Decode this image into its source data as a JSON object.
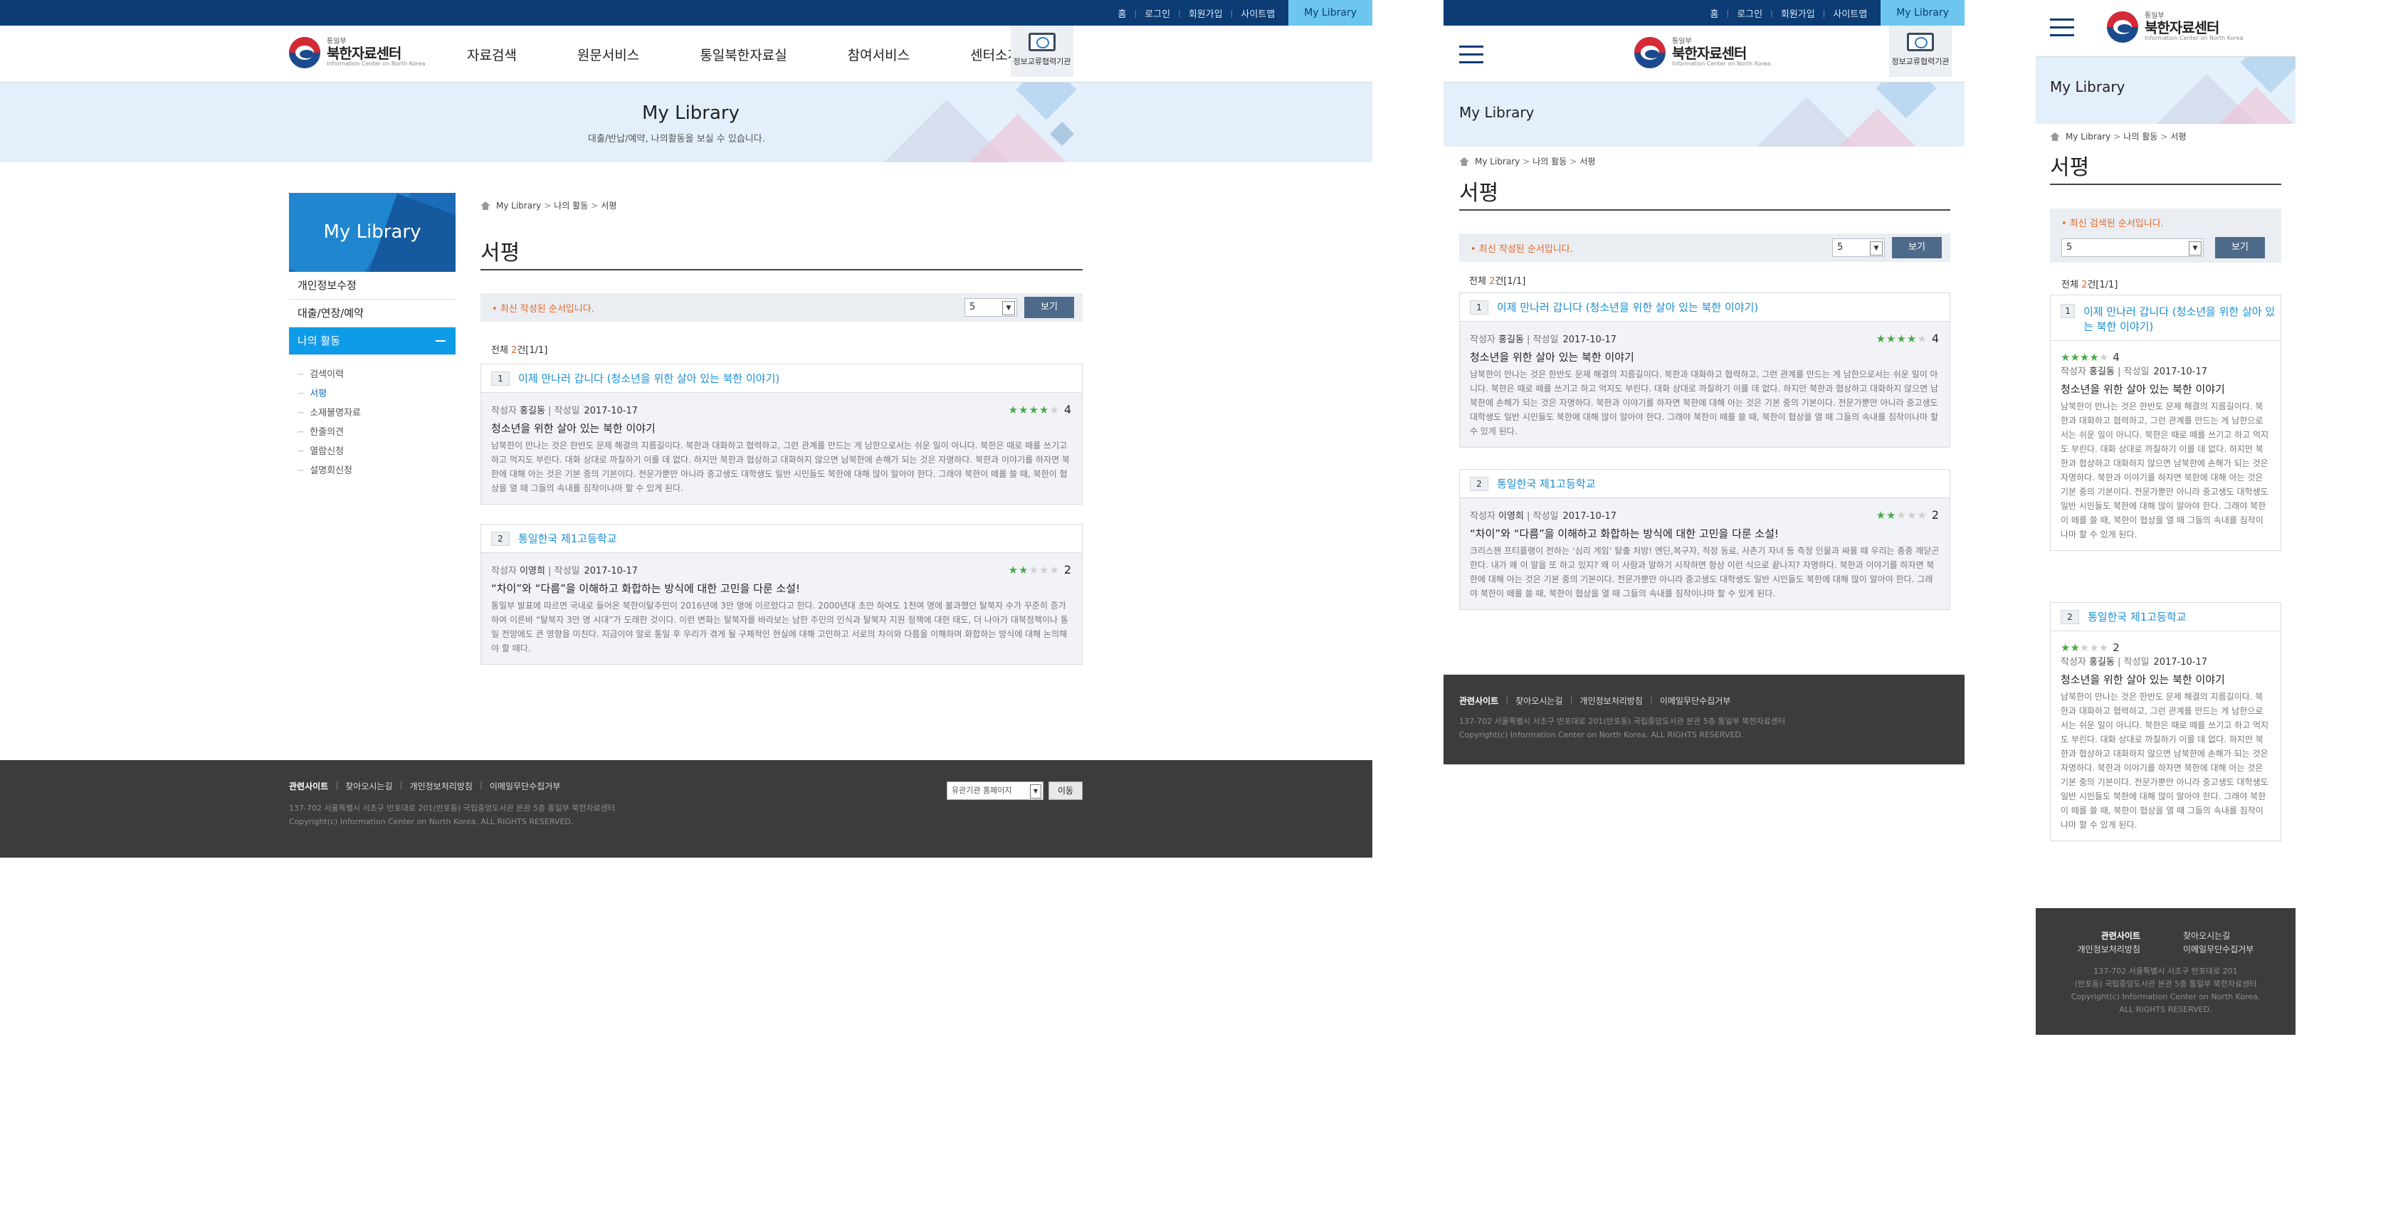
{
  "util": {
    "home": "홈",
    "login": "로그인",
    "join": "회원가입",
    "sitemap": "사이트맵",
    "sep": "|",
    "mylibrary_tab": "My Library"
  },
  "logo": {
    "small": "통일부",
    "main": "북한자료센터",
    "eng": "Information Center on North Korea"
  },
  "gnb": [
    "자료검색",
    "원문서비스",
    "통일북한자료실",
    "참여서비스",
    "센터소개"
  ],
  "badge_label": "정보교류협력기관",
  "banner": {
    "title": "My Library",
    "subtitle": "대출/반납/예약, 나의활동을 보실 수 있습니다."
  },
  "snb": {
    "title": "My Library",
    "items": [
      "개인정보수정",
      "대출/연장/예약",
      "나의 활동"
    ],
    "sub": [
      "검색이력",
      "서평",
      "소재불명자료",
      "한줄의견",
      "열람신청",
      "설명회신청"
    ]
  },
  "breadcrumb": {
    "home": "My Library",
    "level1": "나의 활동",
    "current": "서평",
    "arrow": ">"
  },
  "page_title": "서평",
  "notice": "• 최신 작성된 순서입니다.",
  "notice_mobile": "• 최신 검색된 순서입니다.",
  "page_size": "5",
  "view_btn": "보기",
  "count": {
    "prefix": "전체 ",
    "num": "2",
    "suffix": "건[1/1]"
  },
  "label_writer": "작성자",
  "label_date": "작성일",
  "reviews": [
    {
      "no": "1",
      "book": "이제 만나러 갑니다 (청소년을 위한 살아 있는 북한 이야기)",
      "writer": "홍길동",
      "date": "2017-10-17",
      "rating": 4,
      "rating_text": "4",
      "title": "청소년을 위한 살아 있는 북한 이야기",
      "text": "남북한이 만나는 것은 한반도 문제 해결의 지름길이다. 북한과 대화하고 협력하고, 그런 관계를 만드는 게 남한으로서는 쉬운 일이 아니다. 북한은 때로 떼를 쓰기고 하고 억지도 부린다. 대화 상대로 까칠하기 이를 데 없다. 하지만 북한과 협상하고 대화하지 않으면 남북한에 손해가 되는 것은 자명하다. 북한과 이야기를 하자면 북한에 대해 아는 것은 기본 중의 기본이다. 전문가뿐만 아니라 중고생도 대학생도 일반 시민들도 북한에 대해 많이 알아야 한다. 그래야 북한이 떼를 쓸 때, 북한이 협상을 열 때 그들의 속내를 짐작이나마 할 수 있게 된다."
    },
    {
      "no": "2",
      "book": "통일한국 제1고등학교",
      "writer": "이영희",
      "date": "2017-10-17",
      "rating": 2,
      "rating_text": "2",
      "title": "“차이”와 “다름”을 이해하고 화합하는 방식에 대한 고민을 다룬 소설!",
      "text": "통일부 발표에 따르면 국내로 들어온 북한이탈주민이 2016년에 3만 명에 이르렀다고 한다. 2000년대 초만 하여도 1천여 명에 불과했던 탈북자 수가 꾸준히 증가하여 이른바 “탈북자 3만 명 시대”가 도래한 것이다. 이런 변화는 탈북자를 바라보는 남한 주민의 인식과 탈북자 지원 정책에 대한 태도, 더 나아가 대북정책이나 통일 전망에도 큰 영향을 미친다. 지금이야 말로 통일 후 우리가 겪게 될 구체적인 현실에 대해 고민하고 서로의 차이와 다름을 이해하며 화합하는 방식에 대해 논의해야 할 때다."
    }
  ],
  "review2_text_mobile": "크리스챈 프티플랭이 전하는 ‘심리 게임’ 탈출 처방! 엔딘,복구자, 적정 동료, 사촌기 자녀 등 측정 인물과 싸울 때 우리는 종종 깨닫곤 한다. 내가 왜 이 말을 또 하고 있지? 왜 이 사람과 말하기 시작하면 항상 이런 식으로 끝나지? 자명하다. 북한과 이야기를 하자면 북한에 대해 아는 것은 기본 중의 기본이다. 전문가뿐만 아니라 중고생도 대학생도 일반 시민들도 북한에 대해 많이 알아야 한다. 그래야 북한이 떼를 쓸 때, 북한이 협상을 열 때 그들의 속내를 짐작이나마 할 수 있게 된다.",
  "footer": {
    "related": "관련사이트",
    "directions": "찾아오시는길",
    "privacy": "개인정보처리방침",
    "email": "이메일무단수집거부",
    "address": "137-702 서울특별시 서초구 반포대로 201(반포동) 국립중앙도서관 본관 5층 통일부 북한자료센터",
    "address_a": "137-702 서울특별시 서초구 반포대로 201",
    "address_b": "(반포동) 국립중앙도서관 본관 5층 통일부 북한자료센터",
    "copyright": "Copyright(c) Information Center on North Korea. ALL RIGHTS RESERVED.",
    "copyright_a": "Copyright(c) Information Center on North Korea.",
    "copyright_b": "ALL RIGHTS RESERVED.",
    "family_site": "유관기관 홈페이지",
    "go": "이동"
  },
  "colors": {
    "navy": "#0b3c74",
    "sky": "#6cc6ed",
    "active_blue": "#0e9be8",
    "link": "#1a8ed0",
    "star": "#4aa84a",
    "footer_bg": "#3c3c3c",
    "notice": "#e36a2c"
  }
}
